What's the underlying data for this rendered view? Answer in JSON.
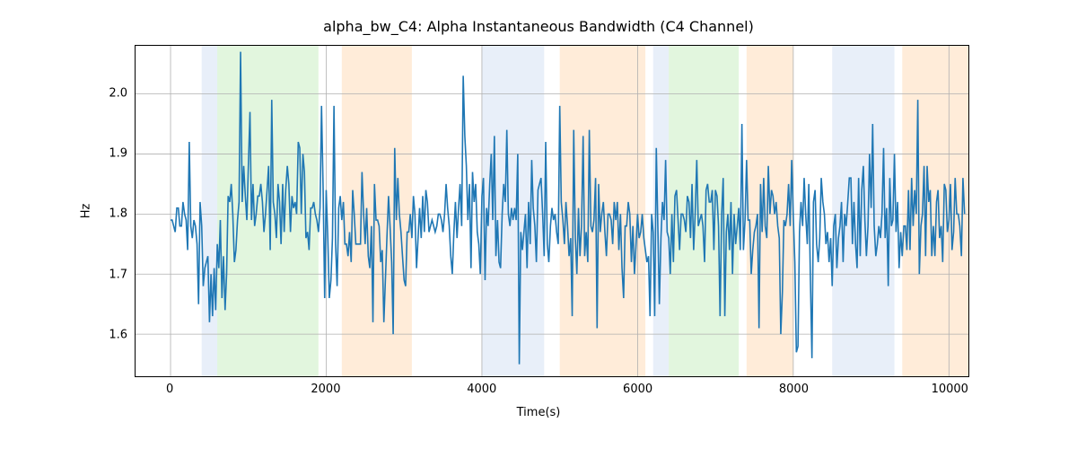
{
  "chart_data": {
    "type": "line",
    "title": "alpha_bw_C4: Alpha Instantaneous Bandwidth (C4 Channel)",
    "xlabel": "Time(s)",
    "ylabel": "Hz",
    "xlim": [
      -450,
      10250
    ],
    "ylim": [
      1.53,
      2.08
    ],
    "xticks": [
      0,
      2000,
      4000,
      6000,
      8000,
      10000
    ],
    "yticks": [
      1.6,
      1.7,
      1.8,
      1.9,
      2.0
    ],
    "bands": [
      {
        "x0": 400,
        "x1": 600,
        "color": "#aec7e8"
      },
      {
        "x0": 600,
        "x1": 1900,
        "color": "#98df8a"
      },
      {
        "x0": 2200,
        "x1": 3100,
        "color": "#ffbb78"
      },
      {
        "x0": 4000,
        "x1": 4800,
        "color": "#aec7e8"
      },
      {
        "x0": 5000,
        "x1": 6100,
        "color": "#ffbb78"
      },
      {
        "x0": 6200,
        "x1": 6400,
        "color": "#aec7e8"
      },
      {
        "x0": 6400,
        "x1": 7300,
        "color": "#98df8a"
      },
      {
        "x0": 7400,
        "x1": 8000,
        "color": "#ffbb78"
      },
      {
        "x0": 8500,
        "x1": 9300,
        "color": "#aec7e8"
      },
      {
        "x0": 9400,
        "x1": 10250,
        "color": "#ffbb78"
      }
    ],
    "series": [
      {
        "name": "alpha_bw_C4",
        "x_step": 20,
        "x_start": 0,
        "values": [
          1.79,
          1.79,
          1.78,
          1.77,
          1.81,
          1.81,
          1.78,
          1.78,
          1.82,
          1.8,
          1.79,
          1.74,
          1.92,
          1.78,
          1.76,
          1.79,
          1.78,
          1.75,
          1.65,
          1.82,
          1.78,
          1.68,
          1.71,
          1.72,
          1.73,
          1.62,
          1.7,
          1.63,
          1.71,
          1.64,
          1.75,
          1.71,
          1.79,
          1.66,
          1.73,
          1.64,
          1.7,
          1.83,
          1.82,
          1.85,
          1.8,
          1.72,
          1.74,
          1.79,
          1.82,
          2.07,
          1.82,
          1.88,
          1.83,
          1.79,
          1.88,
          1.97,
          1.79,
          1.85,
          1.78,
          1.8,
          1.83,
          1.83,
          1.85,
          1.82,
          1.77,
          1.8,
          1.84,
          1.88,
          1.74,
          1.99,
          1.82,
          1.8,
          1.76,
          1.85,
          1.82,
          1.75,
          1.85,
          1.77,
          1.84,
          1.88,
          1.85,
          1.77,
          1.83,
          1.81,
          1.82,
          1.8,
          1.92,
          1.91,
          1.8,
          1.9,
          1.87,
          1.76,
          1.77,
          1.74,
          1.81,
          1.81,
          1.82,
          1.8,
          1.79,
          1.77,
          1.81,
          1.98,
          1.84,
          1.66,
          1.84,
          1.76,
          1.66,
          1.69,
          1.76,
          1.98,
          1.75,
          1.68,
          1.81,
          1.83,
          1.79,
          1.82,
          1.75,
          1.75,
          1.73,
          1.77,
          1.72,
          1.84,
          1.8,
          1.75,
          1.75,
          1.75,
          1.75,
          1.87,
          1.8,
          1.75,
          1.81,
          1.73,
          1.71,
          1.78,
          1.62,
          1.85,
          1.79,
          1.79,
          1.78,
          1.72,
          1.74,
          1.62,
          1.69,
          1.76,
          1.83,
          1.78,
          1.72,
          1.6,
          1.91,
          1.79,
          1.86,
          1.8,
          1.77,
          1.73,
          1.69,
          1.68,
          1.77,
          1.77,
          1.8,
          1.76,
          1.83,
          1.8,
          1.71,
          1.76,
          1.81,
          1.76,
          1.83,
          1.77,
          1.84,
          1.82,
          1.77,
          1.78,
          1.79,
          1.78,
          1.77,
          1.78,
          1.8,
          1.8,
          1.79,
          1.77,
          1.8,
          1.85,
          1.81,
          1.78,
          1.73,
          1.7,
          1.77,
          1.82,
          1.76,
          1.81,
          1.85,
          1.78,
          2.03,
          1.93,
          1.88,
          1.79,
          1.85,
          1.71,
          1.87,
          1.82,
          1.85,
          1.77,
          1.75,
          1.7,
          1.83,
          1.86,
          1.69,
          1.81,
          1.78,
          1.85,
          1.9,
          1.79,
          1.93,
          1.73,
          1.79,
          1.72,
          1.71,
          1.8,
          1.85,
          1.82,
          1.94,
          1.8,
          1.78,
          1.81,
          1.79,
          1.81,
          1.79,
          1.9,
          1.55,
          1.77,
          1.74,
          1.77,
          1.8,
          1.71,
          1.82,
          1.75,
          1.89,
          1.81,
          1.78,
          1.72,
          1.84,
          1.85,
          1.86,
          1.8,
          1.73,
          1.92,
          1.75,
          1.72,
          1.78,
          1.81,
          1.79,
          1.8,
          1.77,
          1.75,
          1.98,
          1.82,
          1.79,
          1.75,
          1.82,
          1.78,
          1.73,
          1.76,
          1.63,
          1.94,
          1.76,
          1.7,
          1.81,
          1.73,
          1.78,
          1.93,
          1.73,
          1.77,
          1.72,
          1.94,
          1.78,
          1.77,
          1.79,
          1.86,
          1.61,
          1.85,
          1.77,
          1.8,
          1.82,
          1.77,
          1.73,
          1.8,
          1.8,
          1.79,
          1.75,
          1.82,
          1.79,
          1.82,
          1.74,
          1.8,
          1.71,
          1.66,
          1.78,
          1.78,
          1.82,
          1.8,
          1.72,
          1.78,
          1.7,
          1.75,
          1.8,
          1.76,
          1.77,
          1.8,
          1.76,
          1.74,
          1.72,
          1.73,
          1.63,
          1.8,
          1.77,
          1.63,
          1.91,
          1.78,
          1.65,
          1.76,
          1.82,
          1.79,
          1.89,
          1.77,
          1.76,
          1.7,
          1.8,
          1.72,
          1.83,
          1.84,
          1.79,
          1.74,
          1.8,
          1.8,
          1.79,
          1.77,
          1.83,
          1.82,
          1.76,
          1.85,
          1.74,
          1.8,
          1.89,
          1.78,
          1.79,
          1.8,
          1.78,
          1.72,
          1.84,
          1.85,
          1.82,
          1.82,
          1.84,
          1.74,
          1.84,
          1.83,
          1.78,
          1.63,
          1.8,
          1.86,
          1.63,
          1.77,
          1.8,
          1.74,
          1.82,
          1.7,
          1.8,
          1.75,
          1.78,
          1.81,
          1.74,
          1.95,
          1.74,
          1.79,
          1.89,
          1.79,
          1.79,
          1.7,
          1.74,
          1.77,
          1.78,
          1.8,
          1.61,
          1.85,
          1.77,
          1.86,
          1.78,
          1.76,
          1.88,
          1.8,
          1.84,
          1.83,
          1.8,
          1.82,
          1.78,
          1.76,
          1.6,
          1.67,
          1.79,
          1.78,
          1.8,
          1.85,
          1.78,
          1.89,
          1.8,
          1.72,
          1.57,
          1.58,
          1.77,
          1.82,
          1.78,
          1.86,
          1.8,
          1.75,
          1.85,
          1.69,
          1.56,
          1.82,
          1.84,
          1.75,
          1.72,
          1.76,
          1.86,
          1.82,
          1.8,
          1.75,
          1.77,
          1.72,
          1.76,
          1.68,
          1.78,
          1.8,
          1.71,
          1.76,
          1.78,
          1.82,
          1.72,
          1.8,
          1.78,
          1.82,
          1.86,
          1.86,
          1.75,
          1.82,
          1.75,
          1.71,
          1.86,
          1.73,
          1.84,
          1.88,
          1.79,
          1.73,
          1.78,
          1.9,
          1.81,
          1.95,
          1.78,
          1.73,
          1.75,
          1.78,
          1.76,
          1.8,
          1.91,
          1.76,
          1.81,
          1.68,
          1.86,
          1.78,
          1.79,
          1.9,
          1.77,
          1.82,
          1.71,
          1.77,
          1.73,
          1.78,
          1.78,
          1.74,
          1.84,
          1.74,
          1.86,
          1.78,
          1.84,
          1.8,
          1.99,
          1.7,
          1.78,
          1.8,
          1.88,
          1.73,
          1.88,
          1.82,
          1.84,
          1.73,
          1.78,
          1.73,
          1.82,
          1.84,
          1.76,
          1.78,
          1.72,
          1.85,
          1.84,
          1.77,
          1.79,
          1.85,
          1.74,
          1.77,
          1.86,
          1.8,
          1.8,
          1.78,
          1.73,
          1.86,
          1.8
        ]
      }
    ]
  }
}
